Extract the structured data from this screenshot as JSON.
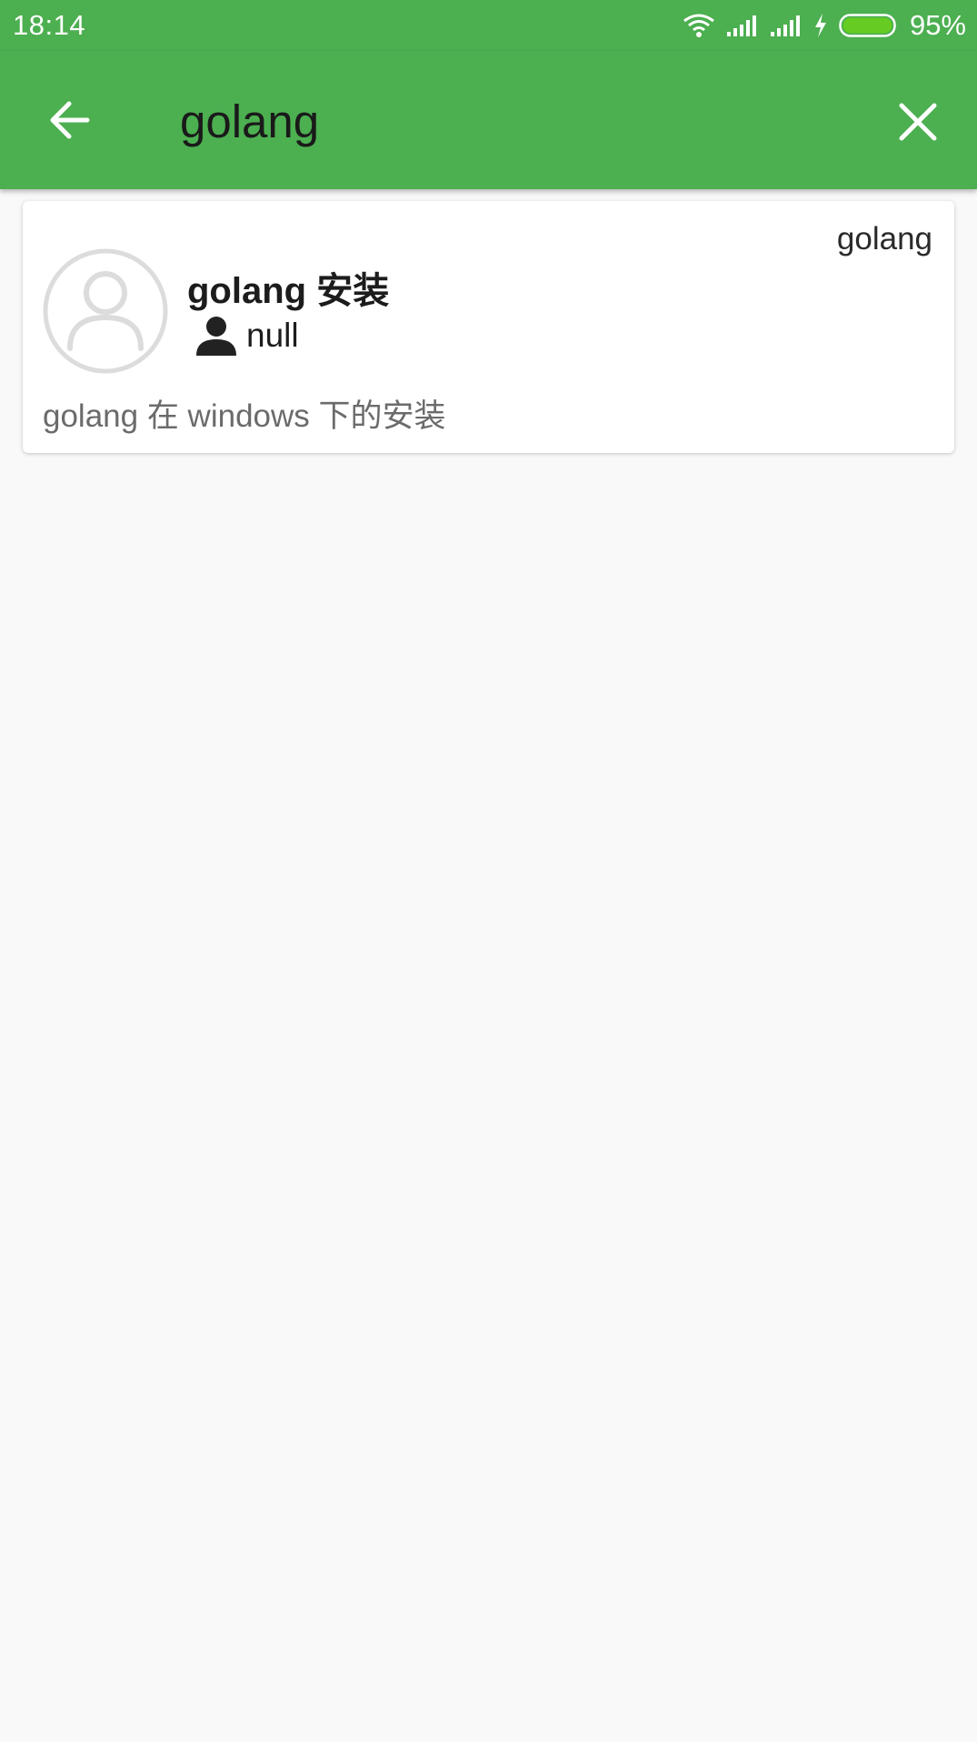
{
  "status_bar": {
    "time": "18:14",
    "battery_percent": "95%",
    "icons": [
      "wifi-icon",
      "signal-icon",
      "signal-icon",
      "charging-icon",
      "battery-icon"
    ],
    "battery_color": "#66cc22"
  },
  "app_bar": {
    "color": "#4caf50",
    "back_icon": "arrow-left-icon",
    "search_query": "golang",
    "clear_icon": "close-icon"
  },
  "results": [
    {
      "avatar_icon": "default-avatar-icon",
      "title": "golang 安装",
      "author_icon": "person-icon",
      "author": "null",
      "tag": "golang",
      "description": "golang 在 windows 下的安装"
    }
  ]
}
